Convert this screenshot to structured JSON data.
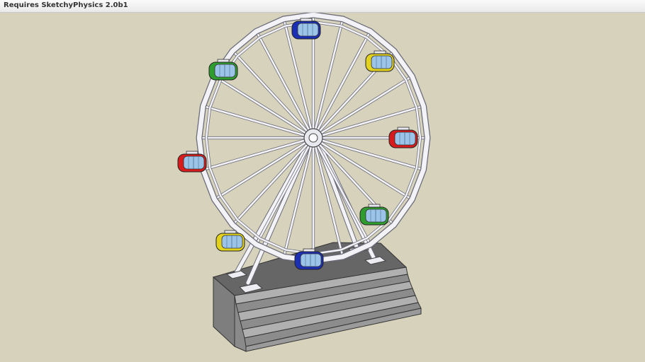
{
  "window": {
    "title": "Requires SketchyPhysics 2.0b1"
  },
  "scene": {
    "subject": "ferris-wheel-model",
    "colors": {
      "background": "#d6d2bb",
      "frame": "#f2f2f7",
      "frame_edge": "#6a6a78",
      "platform_top": "#676767",
      "platform_side": "#8c8c8c",
      "steps": "#a0a0a0",
      "window_glass": "#9cc3e8"
    },
    "gondola_colors": [
      "#1b2fb5",
      "#e2d21e",
      "#d61c1c",
      "#2f9c2f",
      "#1b2fb5",
      "#e2d21e",
      "#d61c1c",
      "#2f9c2f"
    ]
  }
}
